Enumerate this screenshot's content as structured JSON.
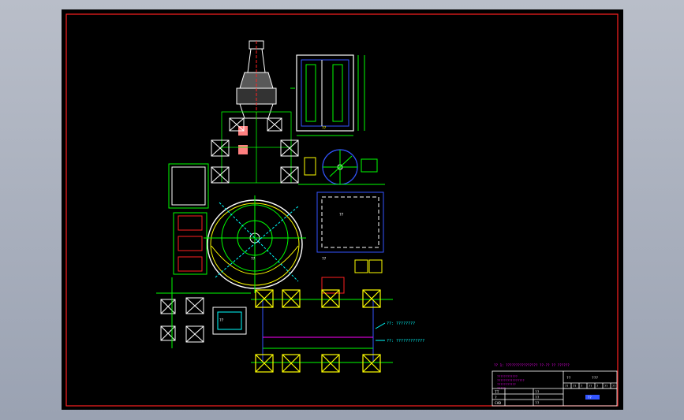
{
  "app": {
    "title": "",
    "view": "model-space"
  },
  "colors": {
    "background": "#000000",
    "frame": "#ff2020",
    "white": "#ffffff",
    "green": "#00ff00",
    "yellow": "#ffff00",
    "magenta": "#ff00ff",
    "cyan": "#00ffff",
    "blue": "#3355ff",
    "pink": "#ff8080"
  },
  "drawing": {
    "dim_labels": [
      "??",
      "??",
      "??",
      "??",
      "??",
      "??",
      "??",
      "??"
    ],
    "title_block": {
      "rows": [
        "TT",
        "?",
        "CAD"
      ],
      "cells": [
        "??",
        "??",
        "??"
      ],
      "header": [
        "??",
        "???"
      ],
      "grid_cells": [
        "??",
        "??",
        "?",
        "??",
        "?",
        "??",
        "??"
      ],
      "stamp": "??"
    },
    "notes": {
      "line_1": "?? 1: ???????????????? ??-?? ?? ??????",
      "block": [
        "????????????",
        "????????????????",
        "???????????",
        "?????"
      ]
    },
    "callouts": [
      "??: ????????",
      "??: ????????????"
    ]
  }
}
